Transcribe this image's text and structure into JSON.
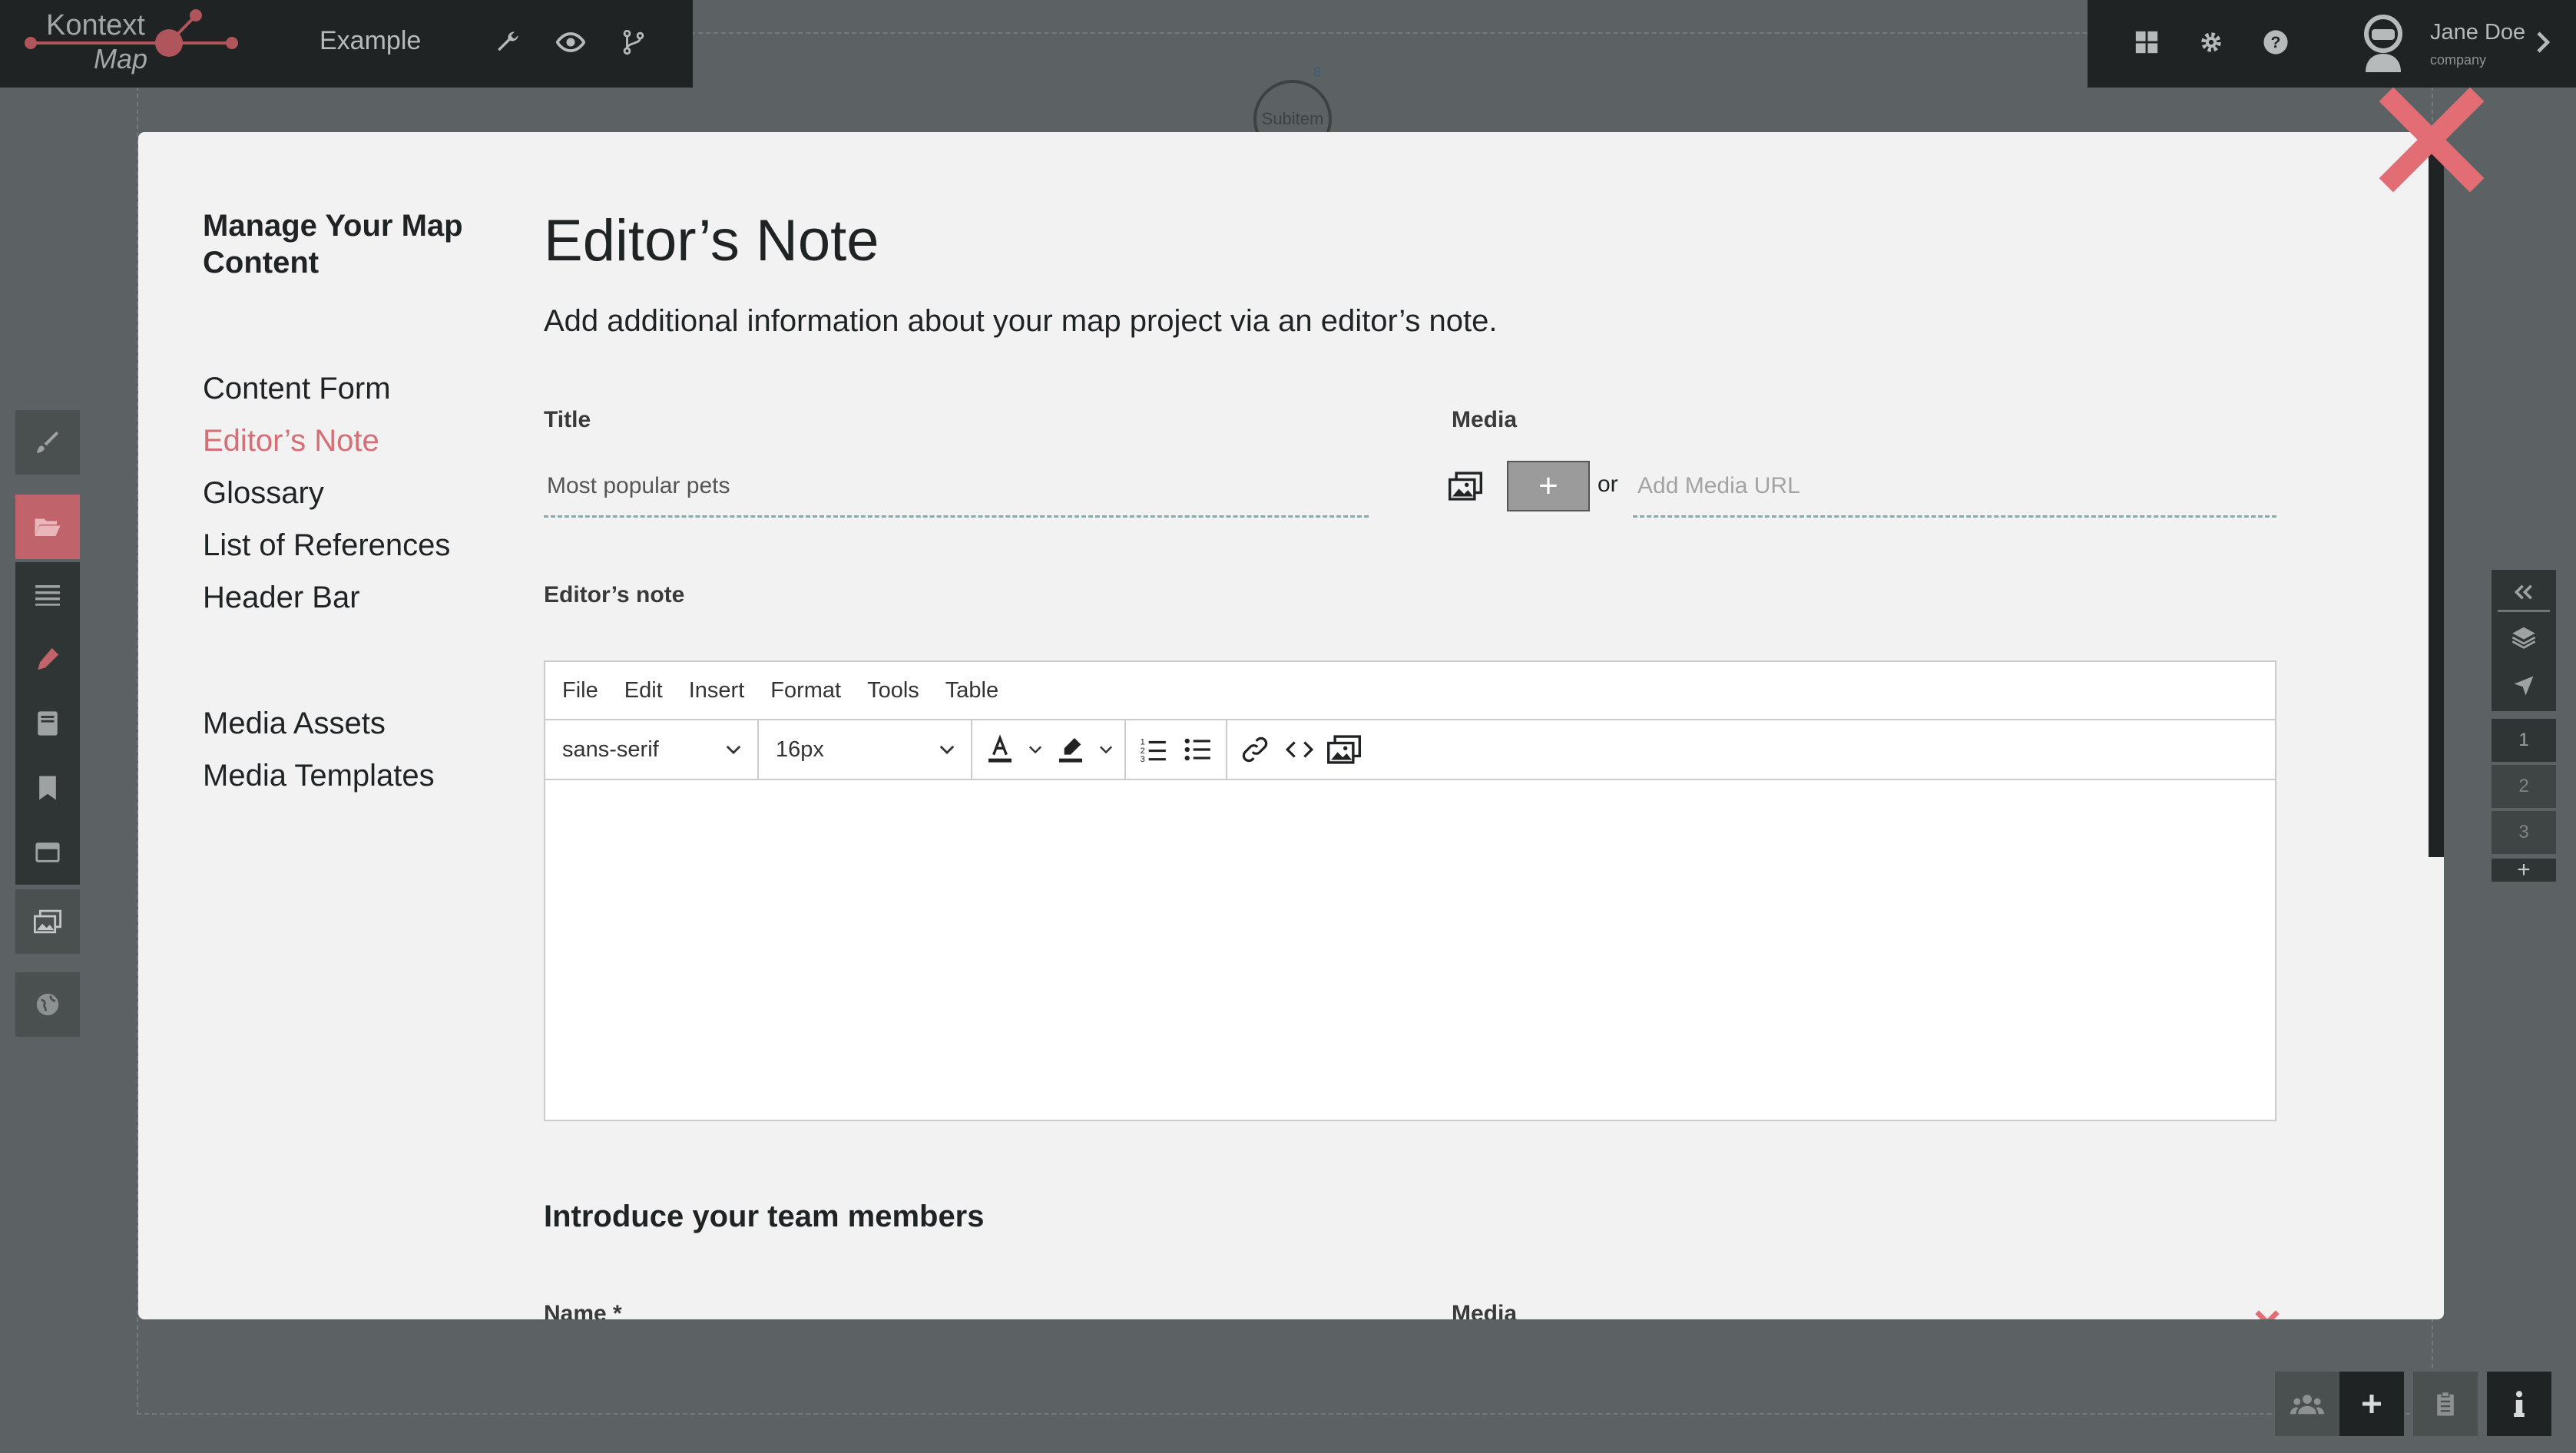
{
  "app": {
    "logo_top": "Kontext",
    "logo_bottom": "Map",
    "project_name": "Example"
  },
  "user": {
    "name": "Jane Doe",
    "company": "company"
  },
  "canvas": {
    "node_label": "Subitem",
    "node_number": "8"
  },
  "sidebar": {
    "heading": "Manage Your Map Content",
    "items": [
      {
        "label": "Content Form"
      },
      {
        "label": "Editor’s Note"
      },
      {
        "label": "Glossary"
      },
      {
        "label": "List of References"
      },
      {
        "label": "Header Bar"
      }
    ],
    "items2": [
      {
        "label": "Media Assets"
      },
      {
        "label": "Media Templates"
      }
    ]
  },
  "main": {
    "title": "Editor’s Note",
    "subtitle": "Add additional information about your map project via an editor’s note.",
    "title_label": "Title",
    "title_value": "Most popular pets",
    "media_label": "Media",
    "or_text": "or",
    "media_url_placeholder": "Add Media URL",
    "plus_label": "+",
    "note_label": "Editor’s note",
    "team_heading": "Introduce your team members",
    "name_label": "Name *",
    "media_label2": "Media"
  },
  "editor": {
    "menu": [
      "File",
      "Edit",
      "Insert",
      "Format",
      "Tools",
      "Table"
    ],
    "font_family": "sans-serif",
    "font_size": "16px"
  },
  "right_panel": {
    "pages": [
      "1",
      "2",
      "3"
    ],
    "add": "+"
  },
  "colors": {
    "accent": "#d66e75",
    "dark": "#1f2324",
    "backdrop": "#5c6263"
  }
}
